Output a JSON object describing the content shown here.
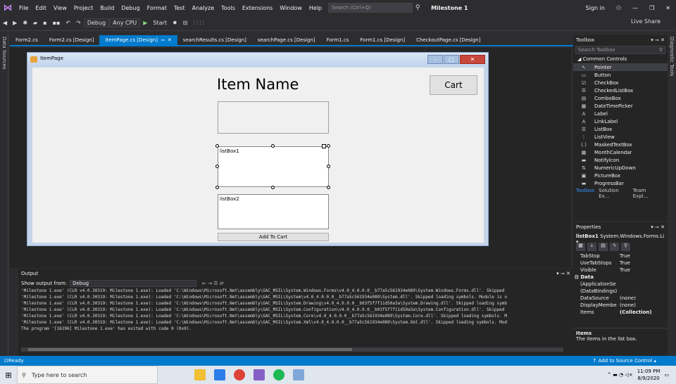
{
  "menubar": {
    "items": [
      "File",
      "Edit",
      "View",
      "Project",
      "Build",
      "Debug",
      "Format",
      "Test",
      "Analyze",
      "Tools",
      "Extensions",
      "Window",
      "Help"
    ],
    "search_placeholder": "Search (Ctrl+Q)",
    "solution": "Milestone 1",
    "sign_in": "Sign in"
  },
  "toolbar": {
    "config": "Debug",
    "platform": "Any CPU",
    "start": "Start",
    "live_share": "Live Share"
  },
  "left_strip": "Data Sources",
  "right_strip": "Diagnostic Tools",
  "tabs": [
    {
      "label": "Form2.cs"
    },
    {
      "label": "Form2.cs [Design]"
    },
    {
      "label": "ItemPage.cs [Design]"
    },
    {
      "label": "searchResults.cs [Design]"
    },
    {
      "label": "searchPage.cs [Design]"
    },
    {
      "label": "Form1.cs"
    },
    {
      "label": "Form1.cs [Design]"
    },
    {
      "label": "CheckoutPage.cs [Design]"
    }
  ],
  "form": {
    "title": "ItemPage",
    "item_name": "Item Name",
    "cart": "Cart",
    "listbox1": "listBox1",
    "listbox2": "listBox2",
    "add_to_cart": "Add To Cart"
  },
  "toolbox": {
    "title": "Toolbox",
    "search": "Search Toolbox",
    "category": "Common Controls",
    "items": [
      {
        "label": "Pointer",
        "icon": "↖"
      },
      {
        "label": "Button",
        "icon": "▭"
      },
      {
        "label": "CheckBox",
        "icon": "☑"
      },
      {
        "label": "CheckedListBox",
        "icon": "☰"
      },
      {
        "label": "ComboBox",
        "icon": "▤"
      },
      {
        "label": "DateTimePicker",
        "icon": "▦"
      },
      {
        "label": "Label",
        "icon": "A"
      },
      {
        "label": "LinkLabel",
        "icon": "A"
      },
      {
        "label": "ListBox",
        "icon": "☰"
      },
      {
        "label": "ListView",
        "icon": "⋮"
      },
      {
        "label": "MaskedTextBox",
        "icon": "(.)"
      },
      {
        "label": "MonthCalendar",
        "icon": "▦"
      },
      {
        "label": "NotifyIcon",
        "icon": "▬"
      },
      {
        "label": "NumericUpDown",
        "icon": "⇅"
      },
      {
        "label": "PictureBox",
        "icon": "▣"
      },
      {
        "label": "ProgressBar",
        "icon": "▬"
      }
    ],
    "bottom_tabs": [
      "Toolbox",
      "Solution Ex...",
      "Team Expl..."
    ]
  },
  "properties": {
    "title": "Properties",
    "object": "listBox1",
    "type": "System.Windows.Forms.Li",
    "rows": [
      {
        "k": "TabStop",
        "v": "True"
      },
      {
        "k": "UseTabStops",
        "v": "True"
      },
      {
        "k": "Visible",
        "v": "True"
      }
    ],
    "data_category": "Data",
    "data_rows": [
      {
        "k": "(ApplicationSe",
        "v": ""
      },
      {
        "k": "(DataBindings)",
        "v": ""
      },
      {
        "k": "DataSource",
        "v": "(none)"
      },
      {
        "k": "DisplayMembe",
        "v": "(none)"
      },
      {
        "k": "Items",
        "v": "(Collection)"
      }
    ],
    "desc_title": "Items",
    "desc_text": "The items in the list box."
  },
  "output": {
    "title": "Output",
    "show_from": "Show output from:",
    "source": "Debug",
    "lines": [
      "'Milestone 1.exe' (CLR v4.0.30319: Milestone 1.exe): Loaded 'C:\\Windows\\Microsoft.Net\\assembly\\GAC_MSIL\\System.Windows.Forms\\v4.0_4.0.0.0__b77a5c561934e089\\System.Windows.Forms.dll'. Skipped",
      "'Milestone 1.exe' (CLR v4.0.30319: Milestone 1.exe): Loaded 'C:\\Windows\\Microsoft.Net\\assembly\\GAC_MSIL\\System\\v4.0_4.0.0.0__b77a5c561934e089\\System.dll'. Skipped loading symbols. Module is o",
      "'Milestone 1.exe' (CLR v4.0.30319: Milestone 1.exe): Loaded 'C:\\Windows\\Microsoft.Net\\assembly\\GAC_MSIL\\System.Drawing\\v4.0_4.0.0.0__b03f5f7f11d50a3a\\System.Drawing.dll'. Skipped loading symb",
      "'Milestone 1.exe' (CLR v4.0.30319: Milestone 1.exe): Loaded 'C:\\Windows\\Microsoft.Net\\assembly\\GAC_MSIL\\System.Configuration\\v4.0_4.0.0.0__b03f5f7f11d50a3a\\System.Configuration.dll'. Skipped",
      "'Milestone 1.exe' (CLR v4.0.30319: Milestone 1.exe): Loaded 'C:\\Windows\\Microsoft.Net\\assembly\\GAC_MSIL\\System.Core\\v4.0_4.0.0.0__b77a5c561934e089\\System.Core.dll'. Skipped loading symbols. M",
      "'Milestone 1.exe' (CLR v4.0.30319: Milestone 1.exe): Loaded 'C:\\Windows\\Microsoft.Net\\assembly\\GAC_MSIL\\System.Xml\\v4.0_4.0.0.0__b77a5c561934e089\\System.Xml.dll'. Skipped loading symbols. Mod",
      "The program '[16296] Milestone 1.exe' has exited with code 0 (0x0)."
    ]
  },
  "status": {
    "ready": "Ready",
    "source_control": "Add to Source Control"
  },
  "taskbar": {
    "search": "Type here to search",
    "time": "11:09 PM",
    "date": "8/9/2020"
  }
}
